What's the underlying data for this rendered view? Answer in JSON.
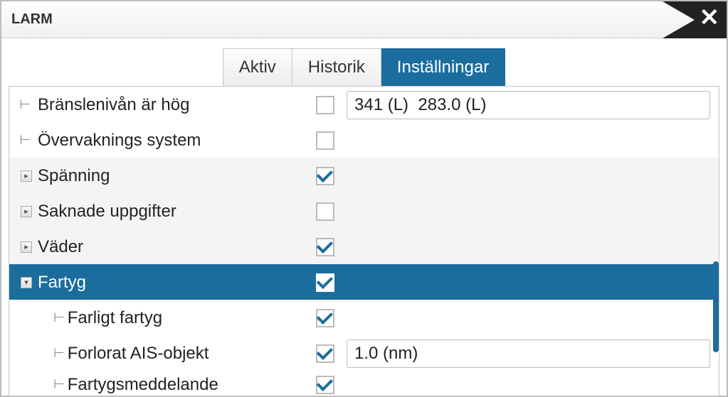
{
  "header": {
    "title": "LARM"
  },
  "tabs": [
    {
      "label": "Aktiv",
      "active": false
    },
    {
      "label": "Historik",
      "active": false
    },
    {
      "label": "Inställningar",
      "active": true
    }
  ],
  "rows": [
    {
      "kind": "leaf",
      "label": "Bränslenivån är hög",
      "checked": false,
      "value": "341 (L)  283.0 (L)"
    },
    {
      "kind": "leaf",
      "label": "Övervaknings system",
      "checked": false
    },
    {
      "kind": "group",
      "label": "Spänning",
      "checked": true,
      "expanded": false
    },
    {
      "kind": "group",
      "label": "Saknade uppgifter",
      "checked": false,
      "expanded": false
    },
    {
      "kind": "group",
      "label": "Väder",
      "checked": true,
      "expanded": false
    },
    {
      "kind": "group",
      "label": "Fartyg",
      "checked": true,
      "expanded": true,
      "selected": true
    },
    {
      "kind": "child",
      "label": "Farligt fartyg",
      "checked": true
    },
    {
      "kind": "child",
      "label": "Forlorat AIS-objekt",
      "checked": true,
      "value": "1.0 (nm)"
    },
    {
      "kind": "child",
      "label": "Fartygsmeddelande",
      "checked": true
    }
  ]
}
